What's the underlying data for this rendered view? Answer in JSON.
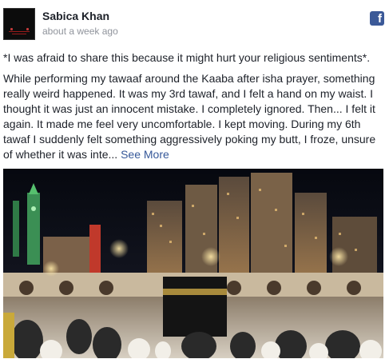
{
  "post": {
    "author": "Sabica Khan",
    "timestamp": "about a week ago",
    "paragraph1": "*I was afraid to share this because it might hurt your religious sentiments*.",
    "paragraph2": "While performing my tawaaf around the Kaaba after isha prayer, something really weird happened. It was my 3rd tawaf, and I felt a hand on my waist. I thought it was just an innocent mistake. I completely ignored. Then... I felt it again. It made me feel very uncomfortable. I kept moving. During my 6th tawaf I suddenly felt something aggressively poking my butt, I froze, unsure of whether it was inte...",
    "see_more_label": "See More"
  },
  "icons": {
    "facebook": "facebook-icon",
    "facebook_glyph": "f"
  },
  "colors": {
    "link": "#365899",
    "facebook_blue": "#3b5998",
    "meta_text": "#90949c"
  }
}
